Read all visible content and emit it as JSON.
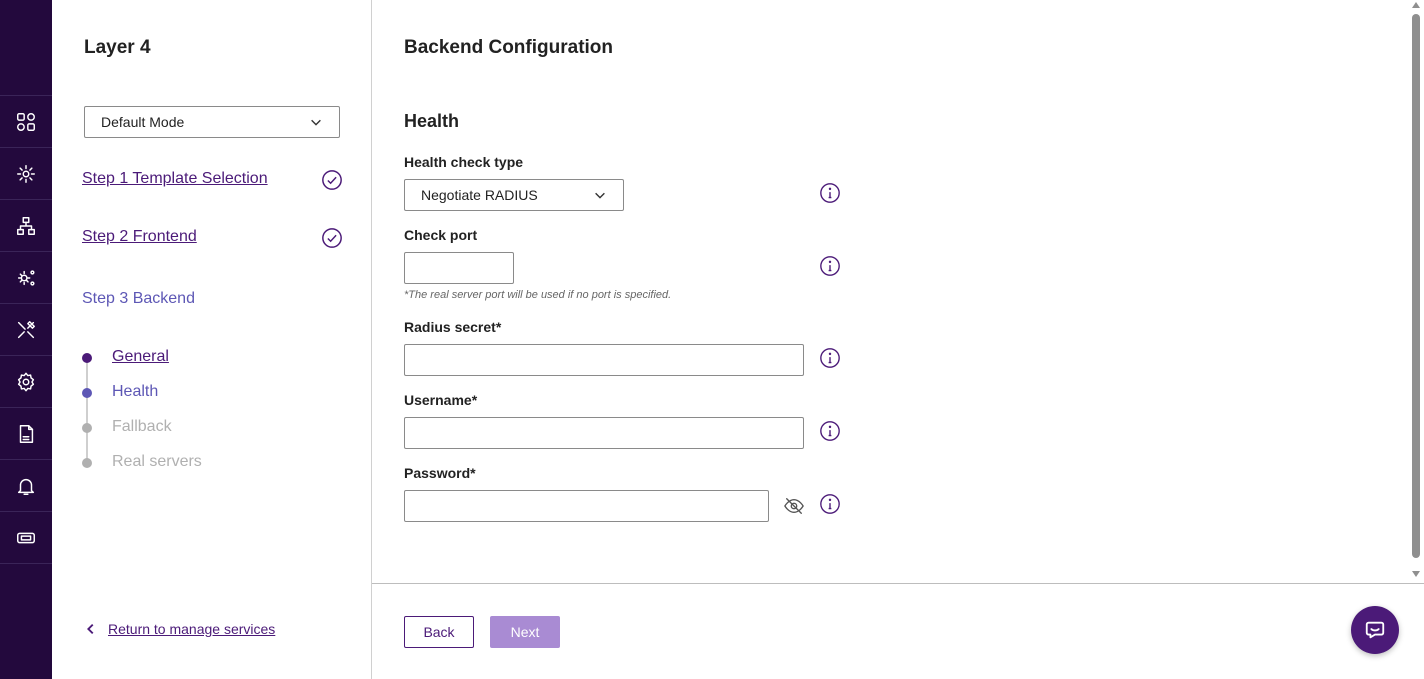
{
  "steps_panel": {
    "title": "Layer 4",
    "mode_select": {
      "value": "Default Mode"
    },
    "steps": [
      {
        "label": "Step 1 Template Selection",
        "completed": true
      },
      {
        "label": "Step 2 Frontend",
        "completed": true
      },
      {
        "label": "Step 3 Backend",
        "completed": false
      }
    ],
    "substeps": [
      {
        "label": "General",
        "state": "visited"
      },
      {
        "label": "Health",
        "state": "current"
      },
      {
        "label": "Fallback",
        "state": "pending"
      },
      {
        "label": "Real servers",
        "state": "pending"
      }
    ],
    "return_link": "Return to manage services"
  },
  "main": {
    "title": "Backend Configuration",
    "section": "Health",
    "fields": {
      "health_check_type": {
        "label": "Health check type",
        "value": "Negotiate RADIUS"
      },
      "check_port": {
        "label": "Check port",
        "value": "",
        "hint": "*The real server port will be used if no port is specified."
      },
      "radius_secret": {
        "label": "Radius secret*",
        "value": ""
      },
      "username": {
        "label": "Username*",
        "value": ""
      },
      "password": {
        "label": "Password*",
        "value": ""
      }
    },
    "buttons": {
      "back": "Back",
      "next": "Next"
    }
  },
  "colors": {
    "rail": "#23093d",
    "primary": "#4b1a78",
    "current_step": "#5d57b5",
    "next_disabled": "#a98bd3",
    "pending": "#b0b0b0"
  },
  "icons": {
    "rail": [
      "dashboard-icon",
      "services-icon",
      "network-icon",
      "system-settings-icon",
      "tools-icon",
      "settings-icon",
      "logs-icon",
      "notifications-icon",
      "license-icon"
    ],
    "chat": "chat-icon"
  }
}
